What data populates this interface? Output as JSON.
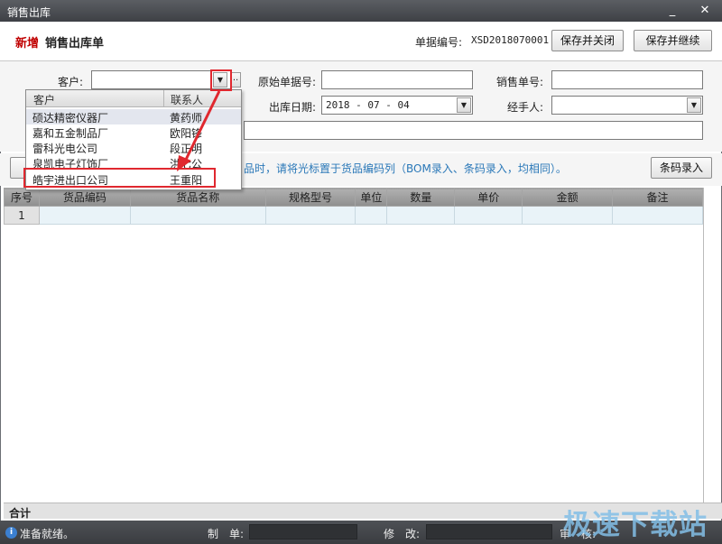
{
  "window": {
    "title": "销售出库",
    "minimize_label": "_",
    "close_label": "✕"
  },
  "header": {
    "new_tag": "新增",
    "title": "销售出库单",
    "docno_label": "单据编号:",
    "docno_value": "XSD2018070001",
    "save_close_label": "保存并关闭",
    "save_continue_label": "保存并继续"
  },
  "form": {
    "customer_label": "客户:",
    "customer_value": "",
    "original_no_label": "原始单据号:",
    "original_no_value": "",
    "sales_no_label": "销售单号:",
    "sales_no_value": "",
    "out_date_label": "出库日期:",
    "out_date_value": "2018 - 07 - 04",
    "handler_label": "经手人:",
    "handler_value": "",
    "remark_value": "",
    "ellipsis_label": ".."
  },
  "toolbar": {
    "hint": "品时，请将光标置于货品编码列（BOM录入、条码录入，均相同）。",
    "barcode_button_label": "条码录入"
  },
  "grid": {
    "columns": [
      "序号",
      "货品编码",
      "货品名称",
      "规格型号",
      "单位",
      "数量",
      "单价",
      "金额",
      "备注"
    ],
    "rows": [
      [
        "1",
        "",
        "",
        "",
        "",
        "",
        "",
        "",
        ""
      ]
    ],
    "total_label": "合计"
  },
  "customer_dropdown": {
    "col_customer": "客户",
    "col_contact": "联系人",
    "items": [
      {
        "customer": "硕达精密仪器厂",
        "contact": "黄药师"
      },
      {
        "customer": "嘉和五金制品厂",
        "contact": "欧阳锋"
      },
      {
        "customer": "雷科光电公司",
        "contact": "段正明"
      },
      {
        "customer": "泉凯电子灯饰厂",
        "contact": "洪七公"
      },
      {
        "customer": "皓宇进出口公司",
        "contact": "王重阳"
      }
    ],
    "highlight_index": 0,
    "annotation_color": "#e0282f"
  },
  "statusbar": {
    "ready_text": "准备就绪。",
    "maker_label": "制　单:",
    "modifier_label": "修　改:",
    "auditor_label": "审　核:"
  },
  "watermark": "极速下载站"
}
